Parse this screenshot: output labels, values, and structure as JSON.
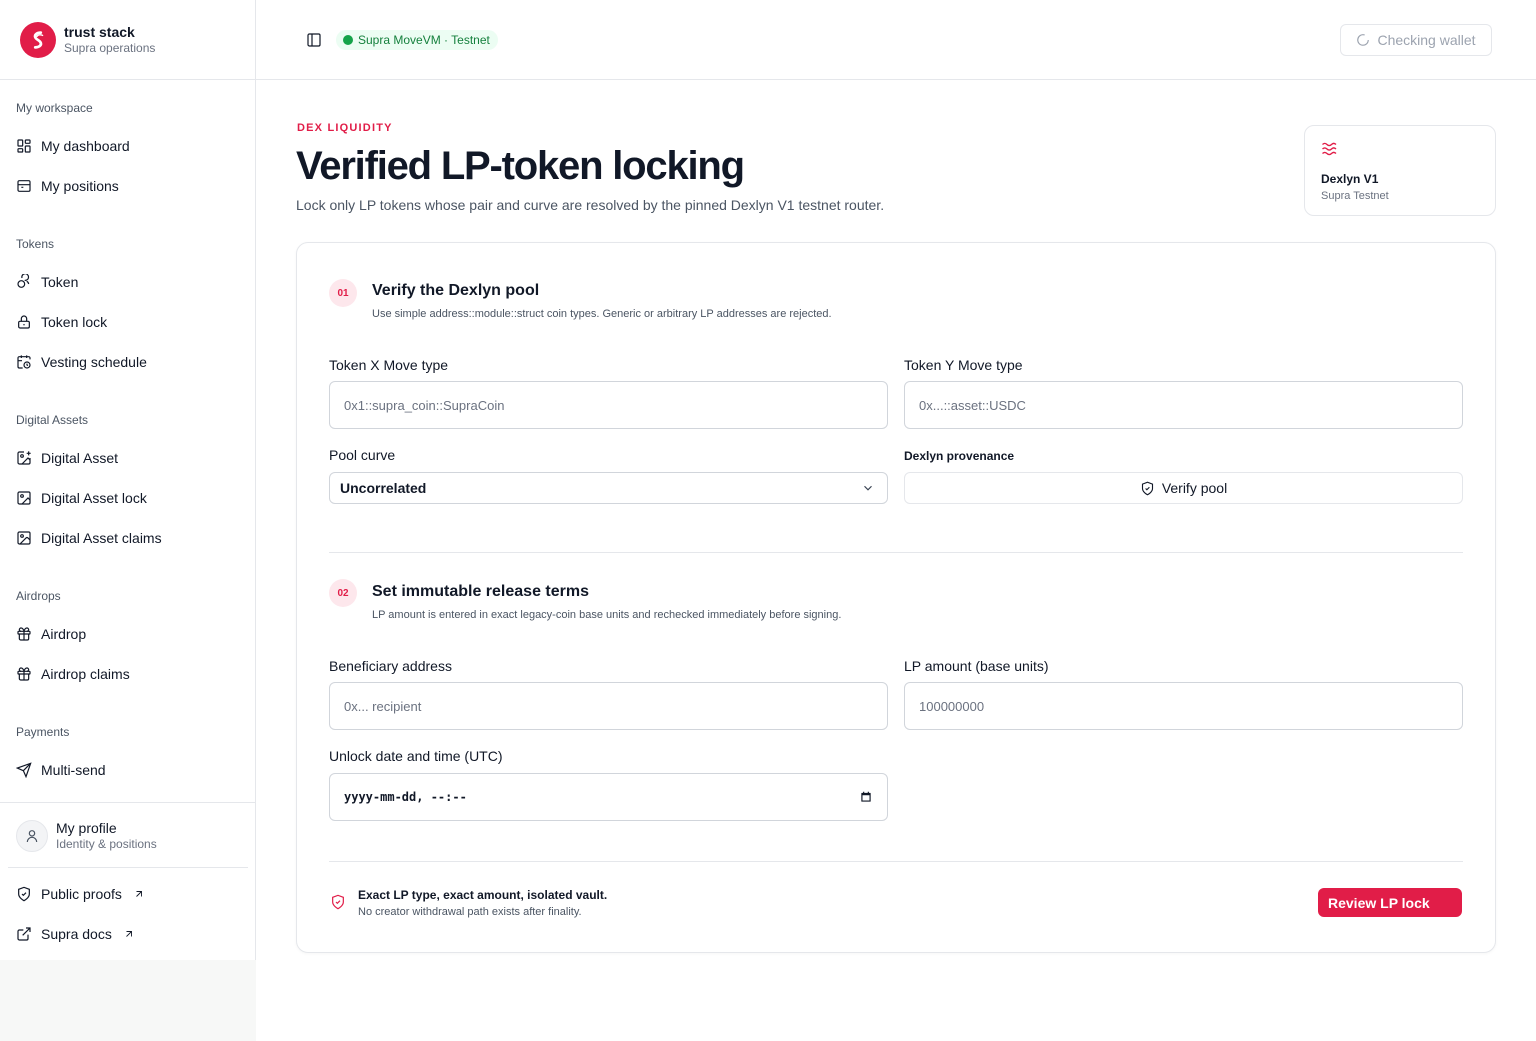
{
  "brand": {
    "name": "trust stack",
    "subtitle": "Supra operations"
  },
  "topbar": {
    "network": "Supra MoveVM · Testnet",
    "wallet_status": "Checking wallet"
  },
  "sidebar": {
    "sections": [
      {
        "title": "My workspace",
        "items": [
          {
            "label": "My dashboard",
            "icon": "dashboard-icon"
          },
          {
            "label": "My positions",
            "icon": "positions-icon"
          }
        ]
      },
      {
        "title": "Tokens",
        "items": [
          {
            "label": "Token",
            "icon": "coins-icon"
          },
          {
            "label": "Token lock",
            "icon": "lock-icon"
          },
          {
            "label": "Vesting schedule",
            "icon": "calendar-clock-icon"
          }
        ]
      },
      {
        "title": "Digital Assets",
        "items": [
          {
            "label": "Digital Asset",
            "icon": "image-plus-icon"
          },
          {
            "label": "Digital Asset lock",
            "icon": "image-lock-icon"
          },
          {
            "label": "Digital Asset claims",
            "icon": "image-icon"
          }
        ]
      },
      {
        "title": "Airdrops",
        "items": [
          {
            "label": "Airdrop",
            "icon": "gift-icon"
          },
          {
            "label": "Airdrop claims",
            "icon": "gift-icon"
          }
        ]
      },
      {
        "title": "Payments",
        "items": [
          {
            "label": "Multi-send",
            "icon": "send-icon"
          }
        ]
      }
    ],
    "profile": {
      "name": "My profile",
      "subtitle": "Identity & positions"
    },
    "links": [
      {
        "label": "Public proofs",
        "icon": "shield-check-icon"
      },
      {
        "label": "Supra docs",
        "icon": "external-link-icon"
      }
    ]
  },
  "header": {
    "eyebrow": "DEX LIQUIDITY",
    "title": "Verified LP-token locking",
    "subtitle": "Lock only LP tokens whose pair and curve are resolved by the pinned Dexlyn V1 testnet router."
  },
  "dex_card": {
    "name": "Dexlyn V1",
    "network": "Supra Testnet"
  },
  "step1": {
    "number": "01",
    "title": "Verify the Dexlyn pool",
    "description": "Use simple address::module::struct coin types. Generic or arbitrary LP addresses are rejected.",
    "token_x_label": "Token X Move type",
    "token_x_placeholder": "0x1::supra_coin::SupraCoin",
    "token_y_label": "Token Y Move type",
    "token_y_placeholder": "0x...::asset::USDC",
    "curve_label": "Pool curve",
    "curve_value": "Uncorrelated",
    "provenance_label": "Dexlyn provenance",
    "verify_button": "Verify pool"
  },
  "step2": {
    "number": "02",
    "title": "Set immutable release terms",
    "description": "LP amount is entered in exact legacy-coin base units and rechecked immediately before signing.",
    "beneficiary_label": "Beneficiary address",
    "beneficiary_placeholder": "0x... recipient",
    "amount_label": "LP amount (base units)",
    "amount_placeholder": "100000000",
    "unlock_label": "Unlock date and time (UTC)",
    "unlock_placeholder": "yyyy-mm-dd, --:--"
  },
  "footer": {
    "title": "Exact LP type, exact amount, isolated vault.",
    "description": "No creator withdrawal path exists after finality.",
    "review_button": "Review LP lock"
  },
  "colors": {
    "accent": "#e11d48",
    "network_green": "#16a34a"
  }
}
